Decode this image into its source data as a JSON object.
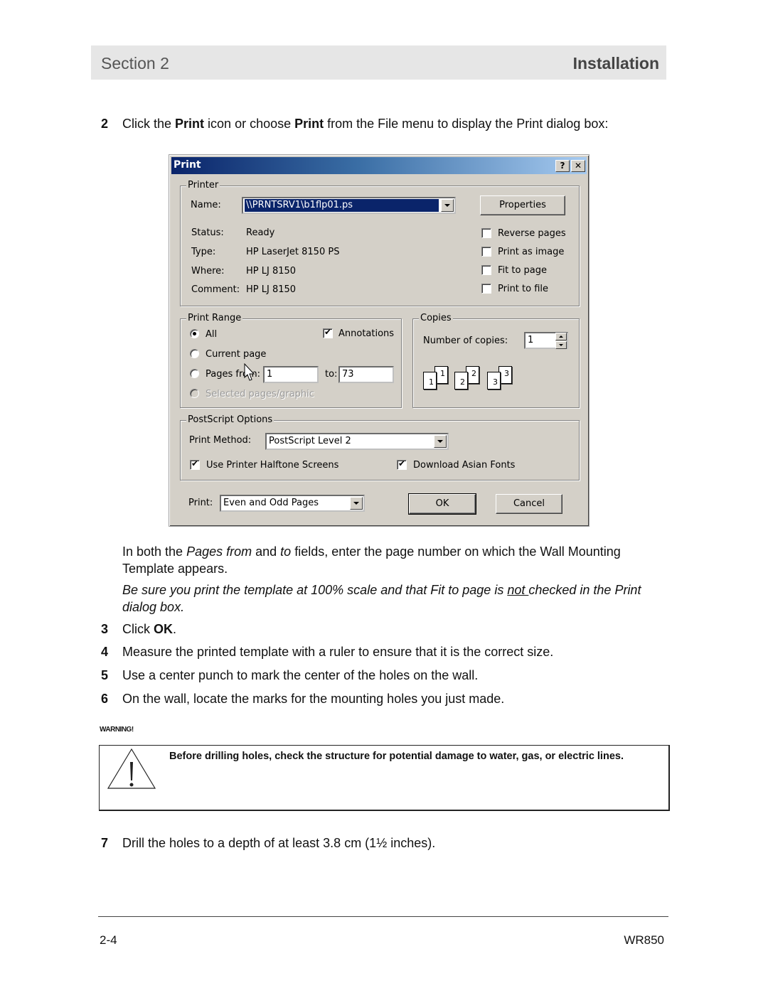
{
  "header": {
    "section": "Section 2",
    "title": "Installation"
  },
  "steps": {
    "step2": {
      "num": "2",
      "pre": "Click the ",
      "b1": "Print",
      "mid": " icon or choose ",
      "b2": "Print",
      "post": " from the File menu to display the Print dialog box:"
    },
    "note1": {
      "pre": "In both the ",
      "i1": "Pages from",
      "mid": " and ",
      "i2": "to",
      "post": " fields, enter the page number on which the Wall Mounting Template appears."
    },
    "note2": {
      "pre": "Be sure you print the template at 100% scale and that Fit to page is ",
      "u": "not ",
      "post": "checked in the Print dialog box."
    },
    "step3": {
      "num": "3",
      "pre": "Click ",
      "b": "OK",
      "post": "."
    },
    "step4": {
      "num": "4",
      "text": "Measure the printed template with a ruler to ensure that it is the correct size."
    },
    "step5": {
      "num": "5",
      "text": "Use a center punch to mark the center of the holes on the wall."
    },
    "step6": {
      "num": "6",
      "text": "On the wall, locate the marks for the mounting holes you just made."
    },
    "step7": {
      "num": "7",
      "text": "Drill the holes to a depth of at least 3.8 cm (1½ inches)."
    }
  },
  "warning": {
    "label": "WARNING!",
    "text": "Before drilling holes, check the structure for potential damage to water, gas, or electric lines."
  },
  "dialog": {
    "title": "Print",
    "help_btn": "?",
    "close_btn": "✕",
    "printer": {
      "group_label": "Printer",
      "name_label": "Name:",
      "name_value": "\\\\PRNTSRV1\\b1flp01.ps",
      "properties_btn": "Properties",
      "status_label": "Status:",
      "status_value": "Ready",
      "type_label": "Type:",
      "type_value": "HP LaserJet 8150 PS",
      "where_label": "Where:",
      "where_value": "HP LJ 8150",
      "comment_label": "Comment:",
      "comment_value": "HP LJ 8150",
      "options": [
        {
          "label": "Reverse pages",
          "checked": false
        },
        {
          "label": "Print as image",
          "checked": false
        },
        {
          "label": "Fit to page",
          "checked": false
        },
        {
          "label": "Print to file",
          "checked": false
        }
      ]
    },
    "range": {
      "group_label": "Print Range",
      "all": "All",
      "current": "Current page",
      "pages": "Pages  from:",
      "from_value": "1",
      "to_label": "to:",
      "to_value": "73",
      "selected": "Selected pages/graphic",
      "annotations": "Annotations",
      "selected_option": "All"
    },
    "copies": {
      "group_label": "Copies",
      "num_label": "Number of copies:",
      "num_value": "1",
      "collate_pages": [
        "1",
        "2",
        "3"
      ]
    },
    "postscript": {
      "group_label": "PostScript Options",
      "method_label": "Print Method:",
      "method_value": "PostScript Level 2",
      "halftone": "Use Printer Halftone Screens",
      "asian_fonts": "Download Asian Fonts"
    },
    "print_label": "Print:",
    "print_value": "Even and Odd Pages",
    "ok_btn": "OK",
    "cancel_btn": "Cancel"
  },
  "footer": {
    "page": "2-4",
    "model": "WR850"
  }
}
